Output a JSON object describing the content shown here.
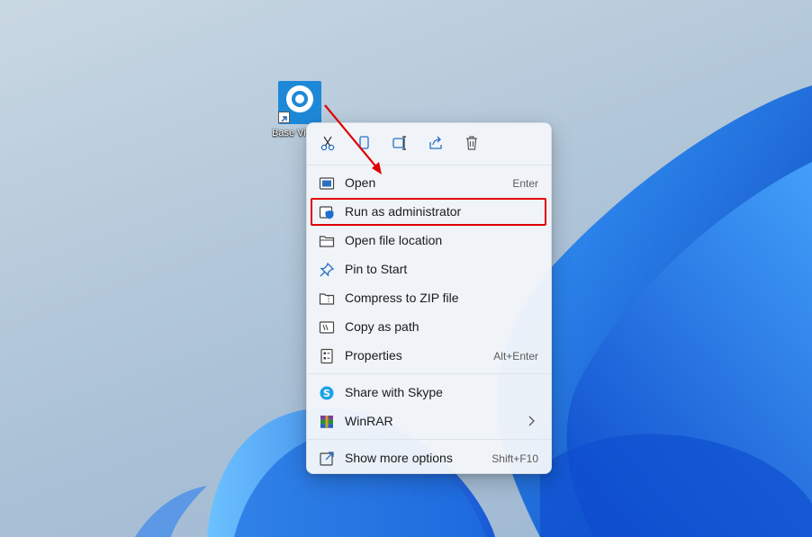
{
  "desktop": {
    "icon": {
      "label": "Base Vi",
      "name": "app-shortcut"
    }
  },
  "context_menu": {
    "quick_actions": [
      {
        "name": "cut-icon",
        "label": "Cut"
      },
      {
        "name": "copy-icon",
        "label": "Copy"
      },
      {
        "name": "rename-icon",
        "label": "Rename"
      },
      {
        "name": "share-icon",
        "label": "Share"
      },
      {
        "name": "delete-icon",
        "label": "Delete"
      }
    ],
    "items": [
      {
        "label": "Open",
        "shortcut": "Enter",
        "icon": "open-window-icon"
      },
      {
        "label": "Run as administrator",
        "shortcut": "",
        "icon": "shield-icon",
        "highlighted": true
      },
      {
        "label": "Open file location",
        "shortcut": "",
        "icon": "folder-icon"
      },
      {
        "label": "Pin to Start",
        "shortcut": "",
        "icon": "pin-icon"
      },
      {
        "label": "Compress to ZIP file",
        "shortcut": "",
        "icon": "zip-folder-icon"
      },
      {
        "label": "Copy as path",
        "shortcut": "",
        "icon": "copy-path-icon"
      },
      {
        "label": "Properties",
        "shortcut": "Alt+Enter",
        "icon": "properties-icon"
      },
      {
        "label": "Share with Skype",
        "shortcut": "",
        "icon": "skype-icon"
      },
      {
        "label": "WinRAR",
        "shortcut": "",
        "icon": "winrar-icon",
        "submenu": true
      },
      {
        "label": "Show more options",
        "shortcut": "Shift+F10",
        "icon": "more-options-icon"
      }
    ]
  },
  "colors": {
    "annotation": "#e00000",
    "accent": "#1e88d8",
    "wallpaper_blue": "#1f6fe0"
  }
}
